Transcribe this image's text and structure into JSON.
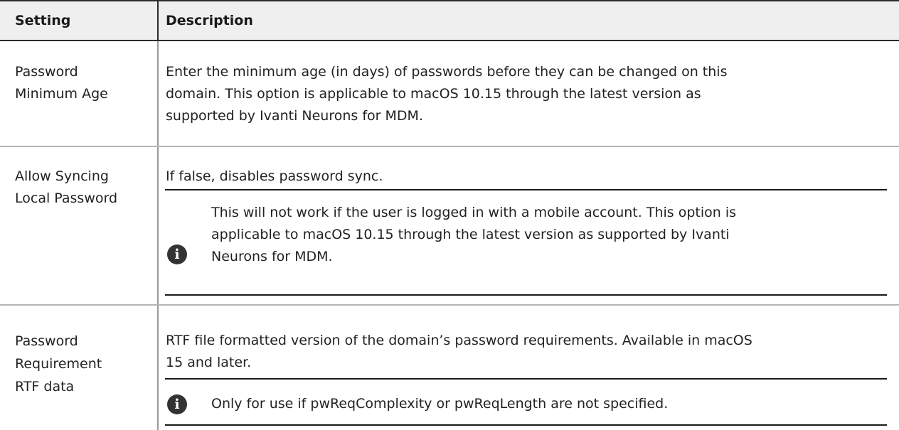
{
  "header": {
    "setting": "Setting",
    "description": "Description"
  },
  "rows": [
    {
      "setting": [
        "Password",
        "Minimum Age"
      ],
      "description": [
        "Enter the minimum age (in days) of passwords before they can be changed on this",
        "domain. This option is applicable to macOS 10.15 through the latest version as",
        "supported by Ivanti Neurons for MDM."
      ]
    },
    {
      "setting": [
        "Allow Syncing",
        "Local Password"
      ],
      "description": [
        "If false, disables password sync."
      ],
      "note": [
        "This will not work if the user is logged in with a mobile account. This option is",
        "applicable to macOS 10.15 through the latest version as supported by Ivanti",
        "Neurons for MDM."
      ]
    },
    {
      "setting": [
        "Password",
        "Requirement",
        "RTF data"
      ],
      "description": [
        "RTF file formatted version of the domain’s password requirements. Available in macOS",
        "15 and later."
      ],
      "note": [
        "Only for use if pwReqComplexity or pwReqLength are not specified."
      ]
    }
  ],
  "icons": {
    "info": "info-icon"
  },
  "info_glyph": "i"
}
